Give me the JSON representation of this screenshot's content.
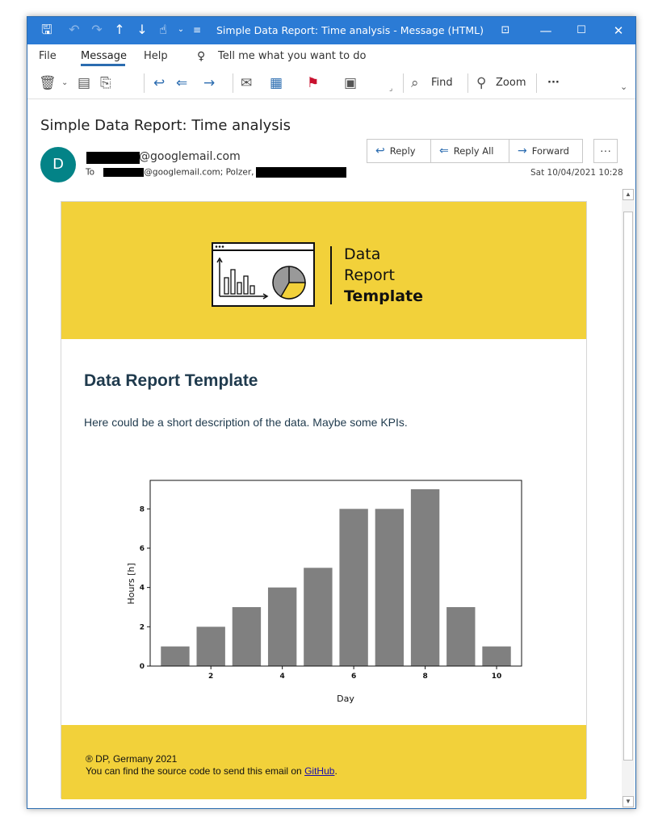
{
  "window": {
    "title": "Simple Data Report: Time analysis  -  Message (HTML)",
    "colors": {
      "titlebar": "#2b7bd5",
      "accent": "#2b6cb0"
    }
  },
  "menu": {
    "file": "File",
    "message": "Message",
    "help": "Help",
    "tell_me": "Tell me what you want to do"
  },
  "ribbon": {
    "find": "Find",
    "zoom": "Zoom",
    "more": "···"
  },
  "message": {
    "subject": "Simple Data Report: Time analysis",
    "avatar_initial": "D",
    "sender_suffix": "@googlemail.com",
    "to_label": "To",
    "to_text": "@googlemail.com; Polzer,",
    "date": "Sat 10/04/2021 10:28",
    "reply": "Reply",
    "reply_all": "Reply All",
    "forward": "Forward",
    "more": "···"
  },
  "email": {
    "logo_line1": "Data",
    "logo_line2": "Report",
    "logo_line3": "Template",
    "title": "Data Report Template",
    "description": "Here could be a short description of the data. Maybe some KPIs.",
    "footer_line1": "® DP, Germany 2021",
    "footer_line2_prefix": "You can find the source code to send this email on ",
    "footer_link": "GitHub",
    "footer_line2_suffix": ".",
    "colors": {
      "banner": "#f2d13a",
      "title": "#1f3a4d"
    }
  },
  "chart_data": {
    "type": "bar",
    "x": [
      1,
      2,
      3,
      4,
      5,
      6,
      7,
      8,
      9,
      10
    ],
    "values": [
      1,
      2,
      3,
      4,
      5,
      8,
      8,
      9,
      3,
      1
    ],
    "xlabel": "Day",
    "ylabel": "Hours [h]",
    "xticks": [
      2,
      4,
      6,
      8,
      10
    ],
    "yticks": [
      0,
      2,
      4,
      6,
      8
    ],
    "xlim": [
      0.3,
      10.7
    ],
    "ylim": [
      0,
      9.45
    ],
    "grid": false,
    "bar_color": "#808080"
  }
}
